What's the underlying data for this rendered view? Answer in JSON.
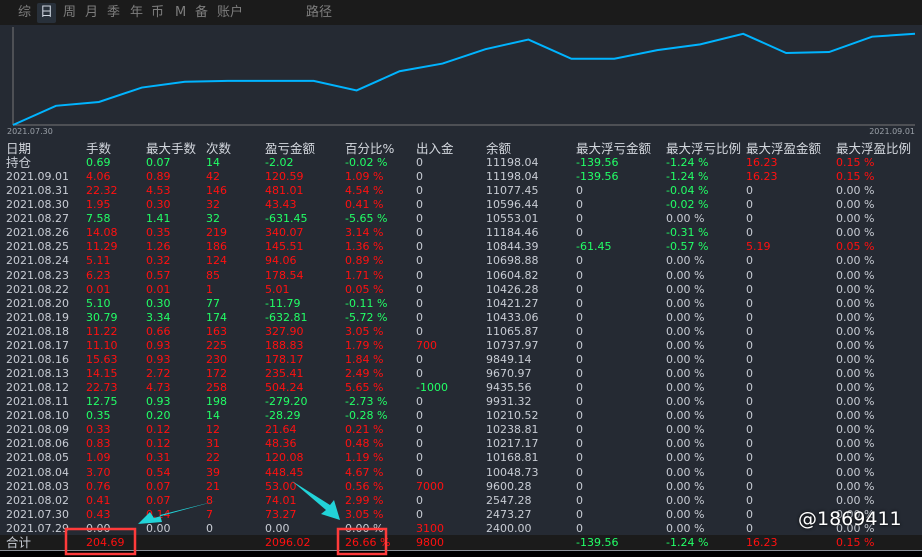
{
  "tabs": [
    "综",
    "日",
    "周",
    "月",
    "季",
    "年",
    "币",
    "M",
    "备",
    "账户",
    "路径"
  ],
  "active_tab": "日",
  "chart_data": {
    "type": "line",
    "x_start_label": "2021.07.30",
    "x_end_label": "2021.09.01",
    "series": [
      {
        "name": "balance-curve",
        "values": [
          0,
          20,
          24,
          39,
          45,
          46,
          46,
          46,
          36,
          56,
          64,
          79,
          89,
          69,
          69,
          78,
          84,
          95,
          75,
          76,
          92,
          95
        ]
      }
    ],
    "ylim": [
      0,
      100
    ],
    "color": "#00b4ff"
  },
  "columns": [
    "日期",
    "手数",
    "最大手数",
    "次数",
    "盈亏金额",
    "百分比%",
    "出入金",
    "余额",
    "最大浮亏金额",
    "最大浮亏比例",
    "最大浮盈金额",
    "最大浮盈比例"
  ],
  "rows": [
    [
      "持仓",
      "0.69",
      "0.07",
      "14",
      "-2.02",
      "-0.02 %",
      "0",
      "11198.04",
      "-139.56",
      "-1.24 %",
      "16.23",
      "0.15 %"
    ],
    [
      "2021.09.01",
      "4.06",
      "0.89",
      "42",
      "120.59",
      "1.09 %",
      "0",
      "11198.04",
      "-139.56",
      "-1.24 %",
      "16.23",
      "0.15 %"
    ],
    [
      "2021.08.31",
      "22.32",
      "4.53",
      "146",
      "481.01",
      "4.54 %",
      "0",
      "11077.45",
      "0",
      "-0.04 %",
      "0",
      "0.00 %"
    ],
    [
      "2021.08.30",
      "1.95",
      "0.30",
      "32",
      "43.43",
      "0.41 %",
      "0",
      "10596.44",
      "0",
      "-0.02 %",
      "0",
      "0.00 %"
    ],
    [
      "2021.08.27",
      "7.58",
      "1.41",
      "32",
      "-631.45",
      "-5.65 %",
      "0",
      "10553.01",
      "0",
      "0.00 %",
      "0",
      "0.00 %"
    ],
    [
      "2021.08.26",
      "14.08",
      "0.35",
      "219",
      "340.07",
      "3.14 %",
      "0",
      "11184.46",
      "0",
      "-0.31 %",
      "0",
      "0.00 %"
    ],
    [
      "2021.08.25",
      "11.29",
      "1.26",
      "186",
      "145.51",
      "1.36 %",
      "0",
      "10844.39",
      "-61.45",
      "-0.57 %",
      "5.19",
      "0.05 %"
    ],
    [
      "2021.08.24",
      "5.11",
      "0.32",
      "124",
      "94.06",
      "0.89 %",
      "0",
      "10698.88",
      "0",
      "0.00 %",
      "0",
      "0.00 %"
    ],
    [
      "2021.08.23",
      "6.23",
      "0.57",
      "85",
      "178.54",
      "1.71 %",
      "0",
      "10604.82",
      "0",
      "0.00 %",
      "0",
      "0.00 %"
    ],
    [
      "2021.08.22",
      "0.01",
      "0.01",
      "1",
      "5.01",
      "0.05 %",
      "0",
      "10426.28",
      "0",
      "0.00 %",
      "0",
      "0.00 %"
    ],
    [
      "2021.08.20",
      "5.10",
      "0.30",
      "77",
      "-11.79",
      "-0.11 %",
      "0",
      "10421.27",
      "0",
      "0.00 %",
      "0",
      "0.00 %"
    ],
    [
      "2021.08.19",
      "30.79",
      "3.34",
      "174",
      "-632.81",
      "-5.72 %",
      "0",
      "10433.06",
      "0",
      "0.00 %",
      "0",
      "0.00 %"
    ],
    [
      "2021.08.18",
      "11.22",
      "0.66",
      "163",
      "327.90",
      "3.05 %",
      "0",
      "11065.87",
      "0",
      "0.00 %",
      "0",
      "0.00 %"
    ],
    [
      "2021.08.17",
      "11.10",
      "0.93",
      "225",
      "188.83",
      "1.79 %",
      "700",
      "10737.97",
      "0",
      "0.00 %",
      "0",
      "0.00 %"
    ],
    [
      "2021.08.16",
      "15.63",
      "0.93",
      "230",
      "178.17",
      "1.84 %",
      "0",
      "9849.14",
      "0",
      "0.00 %",
      "0",
      "0.00 %"
    ],
    [
      "2021.08.13",
      "14.15",
      "2.72",
      "172",
      "235.41",
      "2.49 %",
      "0",
      "9670.97",
      "0",
      "0.00 %",
      "0",
      "0.00 %"
    ],
    [
      "2021.08.12",
      "22.73",
      "4.73",
      "258",
      "504.24",
      "5.65 %",
      "-1000",
      "9435.56",
      "0",
      "0.00 %",
      "0",
      "0.00 %"
    ],
    [
      "2021.08.11",
      "12.75",
      "0.93",
      "198",
      "-279.20",
      "-2.73 %",
      "0",
      "9931.32",
      "0",
      "0.00 %",
      "0",
      "0.00 %"
    ],
    [
      "2021.08.10",
      "0.35",
      "0.20",
      "14",
      "-28.29",
      "-0.28 %",
      "0",
      "10210.52",
      "0",
      "0.00 %",
      "0",
      "0.00 %"
    ],
    [
      "2021.08.09",
      "0.33",
      "0.12",
      "12",
      "21.64",
      "0.21 %",
      "0",
      "10238.81",
      "0",
      "0.00 %",
      "0",
      "0.00 %"
    ],
    [
      "2021.08.06",
      "0.83",
      "0.12",
      "31",
      "48.36",
      "0.48 %",
      "0",
      "10217.17",
      "0",
      "0.00 %",
      "0",
      "0.00 %"
    ],
    [
      "2021.08.05",
      "1.09",
      "0.31",
      "22",
      "120.08",
      "1.19 %",
      "0",
      "10168.81",
      "0",
      "0.00 %",
      "0",
      "0.00 %"
    ],
    [
      "2021.08.04",
      "3.70",
      "0.54",
      "39",
      "448.45",
      "4.67 %",
      "0",
      "10048.73",
      "0",
      "0.00 %",
      "0",
      "0.00 %"
    ],
    [
      "2021.08.03",
      "0.76",
      "0.07",
      "21",
      "53.00",
      "0.56 %",
      "7000",
      "9600.28",
      "0",
      "0.00 %",
      "0",
      "0.00 %"
    ],
    [
      "2021.08.02",
      "0.41",
      "0.07",
      "8",
      "74.01",
      "2.99 %",
      "0",
      "2547.28",
      "0",
      "0.00 %",
      "0",
      "0.00 %"
    ],
    [
      "2021.07.30",
      "0.43",
      "0.14",
      "7",
      "73.27",
      "3.05 %",
      "0",
      "2473.27",
      "0",
      "0.00 %",
      "0",
      "0.00 %"
    ],
    [
      "2021.07.29",
      "0.00",
      "0.00",
      "0",
      "0.00",
      "0.00 %",
      "3100",
      "2400.00",
      "0",
      "0.00 %",
      "0",
      "0.00 %"
    ]
  ],
  "total": [
    "合计",
    "204.69",
    "",
    "",
    "2096.02",
    "26.66 %",
    "9800",
    "",
    "-139.56",
    "-1.24 %",
    "16.23",
    "0.15 %"
  ],
  "watermark": "@1869411"
}
